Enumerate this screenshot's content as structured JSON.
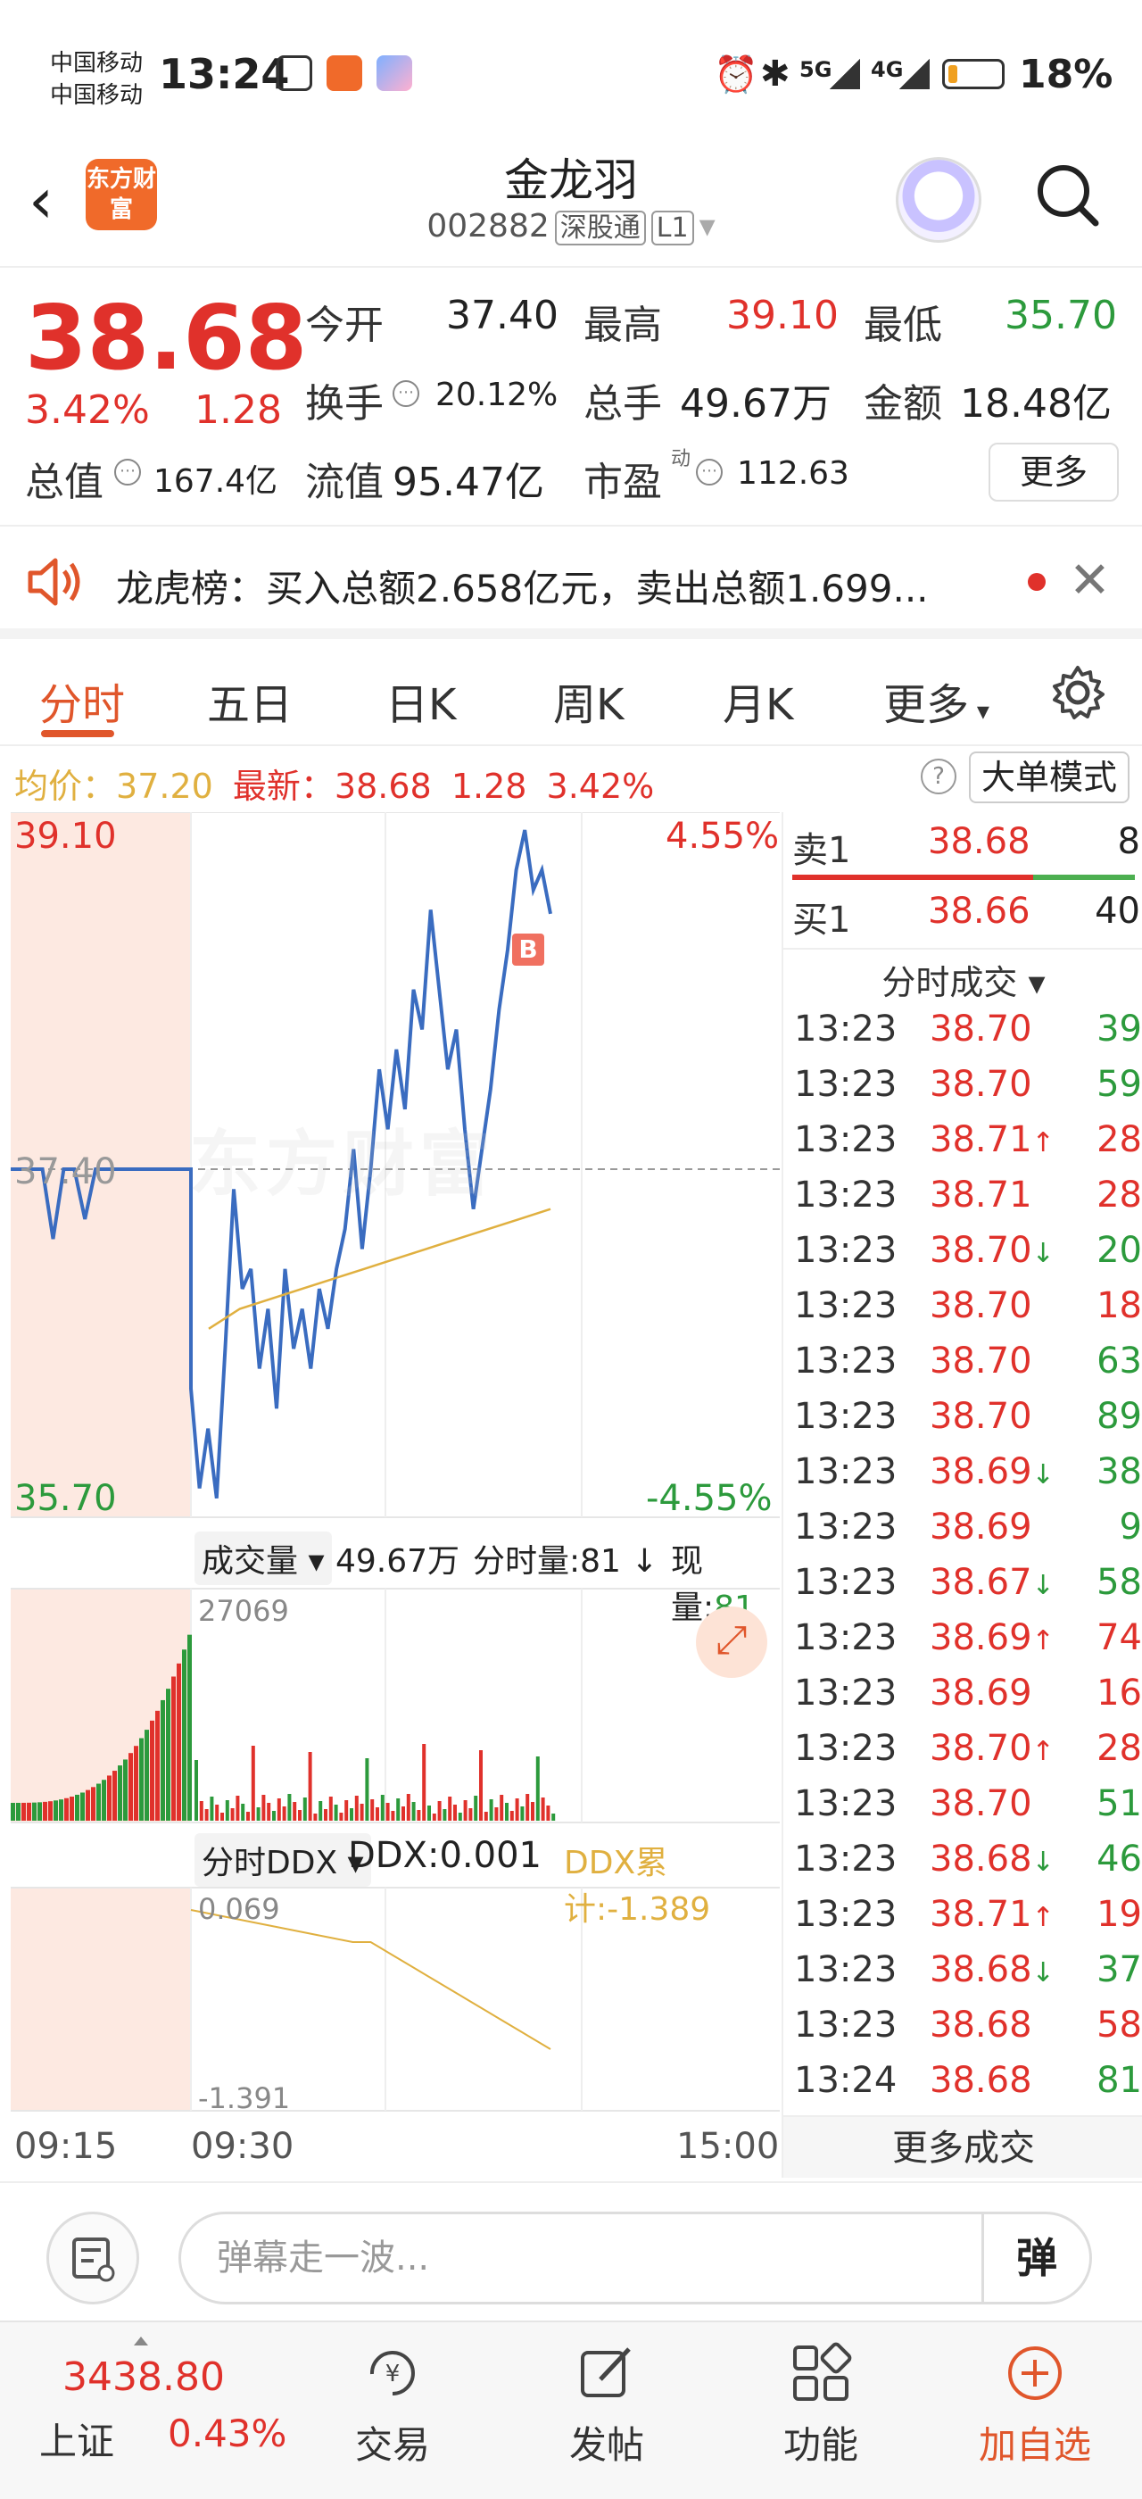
{
  "status_bar": {
    "carrier1": "中国移动",
    "carrier2": "中国移动",
    "time": "13:24",
    "signal1": "5G",
    "signal2": "4G",
    "battery": "18%",
    "battery_level": 0.18
  },
  "header": {
    "logo_text": "东方财富",
    "stock_name": "金龙羽",
    "stock_code": "002882",
    "tag1": "深股通",
    "tag2": "L1"
  },
  "quote": {
    "price": "38.68",
    "change_pct": "3.42%",
    "change": "1.28",
    "open_label": "今开",
    "open": "37.40",
    "high_label": "最高",
    "high": "39.10",
    "low_label": "最低",
    "low": "35.70",
    "turnover_label": "换手",
    "turnover": "20.12%",
    "volume_label": "总手",
    "volume": "49.67万",
    "amount_label": "金额",
    "amount": "18.48亿",
    "mktcap_label": "总值",
    "mktcap": "167.4亿",
    "float_label": "流值",
    "float": "95.47亿",
    "pe_label": "市盈",
    "pe_sup": "动",
    "pe": "112.63",
    "more_label": "更多"
  },
  "notice": {
    "text": "龙虎榜：买入总额2.658亿元，卖出总额1.699..."
  },
  "tabs": [
    "分时",
    "五日",
    "日K",
    "周K",
    "月K",
    "更多"
  ],
  "info_line": {
    "avg_label": "均价：",
    "avg": "37.20",
    "latest_label": "最新：",
    "latest": "38.68",
    "change": "1.28",
    "change_pct": "3.42%",
    "mode_label": "大单模式"
  },
  "chart": {
    "price_top": "39.10",
    "price_mid": "37.40",
    "price_bottom": "35.70",
    "pct_top": "4.55%",
    "pct_bottom": "-4.55%",
    "watermark": "东方财富",
    "b_marker": "B",
    "vol_selector": "成交量",
    "vol_total": "49.67万",
    "vol_tick_label": "分时量:81",
    "vol_now_label": "现量:",
    "vol_now": "81",
    "vol_max": "27069",
    "ddx_selector": "分时DDX",
    "ddx_value": "DDX:0.001",
    "ddx_cum": "DDX累计:-1.389",
    "ddx_top": "0.069",
    "ddx_bottom": "-1.391",
    "time_start": "09:15",
    "time_open": "09:30",
    "time_end": "15:00"
  },
  "chart_data": {
    "type": "line",
    "ylim": [
      35.7,
      39.1
    ],
    "prev_close": 37.4,
    "price_series": [
      37.4,
      37.4,
      37.4,
      37.4,
      37.05,
      37.4,
      37.4,
      37.15,
      37.4,
      37.4,
      37.4,
      37.4,
      37.4,
      37.4,
      37.4,
      37.4,
      37.4,
      37.4,
      36.3,
      35.8,
      36.1,
      35.75,
      36.5,
      37.3,
      36.8,
      36.9,
      36.4,
      36.7,
      36.2,
      36.9,
      36.5,
      36.7,
      36.4,
      36.8,
      36.6,
      36.9,
      37.1,
      37.5,
      37.0,
      37.4,
      37.9,
      37.6,
      38.0,
      37.7,
      38.3,
      38.1,
      38.7,
      38.3,
      37.9,
      38.1,
      37.6,
      37.2,
      37.5,
      37.8,
      38.2,
      38.5,
      38.9,
      39.1,
      38.8,
      38.9,
      38.68
    ],
    "avg_series": [
      36.6,
      36.7,
      36.75,
      36.8,
      36.85,
      36.9,
      36.95,
      37.0,
      37.05,
      37.1,
      37.15,
      37.2
    ]
  },
  "orderbook": {
    "sell1_label": "卖1",
    "sell1_price": "38.68",
    "sell1_vol": "8",
    "buy1_label": "买1",
    "buy1_price": "38.66",
    "buy1_vol": "40",
    "trades_title": "分时成交",
    "more_trades": "更多成交"
  },
  "trades": [
    {
      "time": "13:23",
      "price": "38.70",
      "vol": "39",
      "arrow": ""
    },
    {
      "time": "13:23",
      "price": "38.70",
      "vol": "59",
      "arrow": ""
    },
    {
      "time": "13:23",
      "price": "38.71",
      "vol": "28",
      "arrow": "↑"
    },
    {
      "time": "13:23",
      "price": "38.71",
      "vol": "28",
      "arrow": ""
    },
    {
      "time": "13:23",
      "price": "38.70",
      "vol": "20",
      "arrow": "↓"
    },
    {
      "time": "13:23",
      "price": "38.70",
      "vol": "18",
      "arrow": ""
    },
    {
      "time": "13:23",
      "price": "38.70",
      "vol": "63",
      "arrow": ""
    },
    {
      "time": "13:23",
      "price": "38.70",
      "vol": "89",
      "arrow": ""
    },
    {
      "time": "13:23",
      "price": "38.69",
      "vol": "38",
      "arrow": "↓"
    },
    {
      "time": "13:23",
      "price": "38.69",
      "vol": "9",
      "arrow": ""
    },
    {
      "time": "13:23",
      "price": "38.67",
      "vol": "58",
      "arrow": "↓"
    },
    {
      "time": "13:23",
      "price": "38.69",
      "vol": "74",
      "arrow": "↑"
    },
    {
      "time": "13:23",
      "price": "38.69",
      "vol": "16",
      "arrow": ""
    },
    {
      "time": "13:23",
      "price": "38.70",
      "vol": "28",
      "arrow": "↑"
    },
    {
      "time": "13:23",
      "price": "38.70",
      "vol": "51",
      "arrow": ""
    },
    {
      "time": "13:23",
      "price": "38.68",
      "vol": "46",
      "arrow": "↓"
    },
    {
      "time": "13:23",
      "price": "38.71",
      "vol": "19",
      "arrow": "↑"
    },
    {
      "time": "13:23",
      "price": "38.68",
      "vol": "37",
      "arrow": "↓"
    },
    {
      "time": "13:23",
      "price": "38.68",
      "vol": "58",
      "arrow": ""
    },
    {
      "time": "13:24",
      "price": "38.68",
      "vol": "81",
      "arrow": ""
    }
  ],
  "comment": {
    "placeholder": "弹幕走一波...",
    "danmu": "弹"
  },
  "bottom_nav": {
    "index_value": "3438.80",
    "index_name": "上证",
    "index_pct": "0.43%",
    "trade": "交易",
    "post": "发帖",
    "features": "功能",
    "add_watch": "加自选"
  },
  "colors": {
    "up": "#e0312b",
    "down": "#2c9a3c",
    "accent": "#e0562b",
    "price_line": "#3a6cc0",
    "avg_line": "#e0b040"
  }
}
